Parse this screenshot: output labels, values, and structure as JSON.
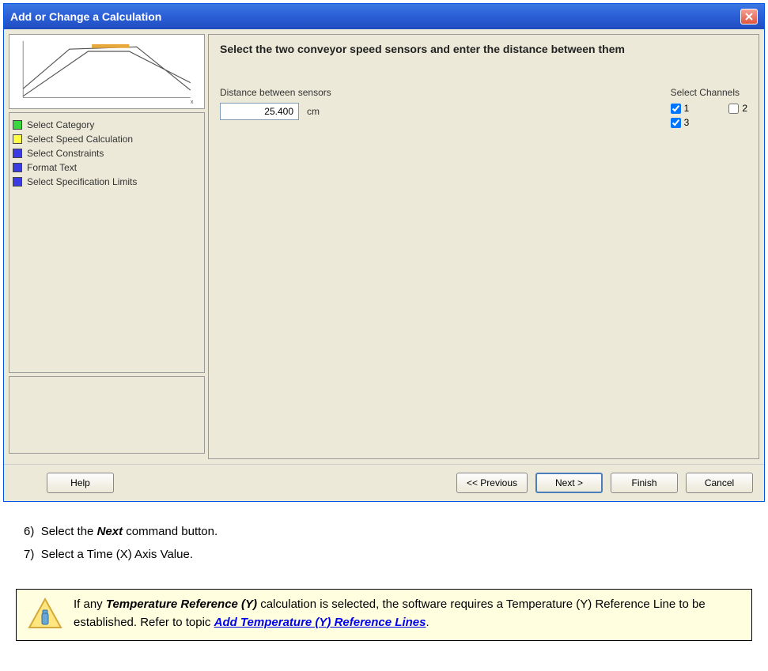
{
  "window": {
    "title": "Add or Change a Calculation"
  },
  "steps": [
    {
      "color": "#3BD63B",
      "label": "Select Category"
    },
    {
      "color": "#FFFF44",
      "label": "Select Speed Calculation"
    },
    {
      "color": "#3B3BE3",
      "label": "Select Constraints"
    },
    {
      "color": "#3B3BE3",
      "label": "Format Text"
    },
    {
      "color": "#3B3BE3",
      "label": "Select Specification Limits"
    }
  ],
  "main": {
    "heading": "Select the two conveyor speed sensors and enter the distance between them",
    "distance_label": "Distance between sensors",
    "distance_value": "25.400",
    "distance_unit": "cm",
    "channels_label": "Select Channels",
    "channels": [
      {
        "num": "1",
        "checked": true
      },
      {
        "num": "2",
        "checked": false
      },
      {
        "num": "3",
        "checked": true
      }
    ]
  },
  "buttons": {
    "help": "Help",
    "previous": "<< Previous",
    "next": "Next >",
    "finish": "Finish",
    "cancel": "Cancel"
  },
  "instructions": {
    "step6_num": "6)",
    "step6_pre": "Select the ",
    "step6_emph": "Next",
    "step6_post": " command button.",
    "step7_num": "7)",
    "step7_text": "Select a Time (X) Axis Value."
  },
  "note": {
    "pre": "If any ",
    "emph": "Temperature Reference (Y)",
    "mid": " calculation is selected, the software requires a Temperature (Y) Reference Line to be established. Refer to topic ",
    "link": "Add Temperature (Y) Reference Lines",
    "post": "."
  }
}
